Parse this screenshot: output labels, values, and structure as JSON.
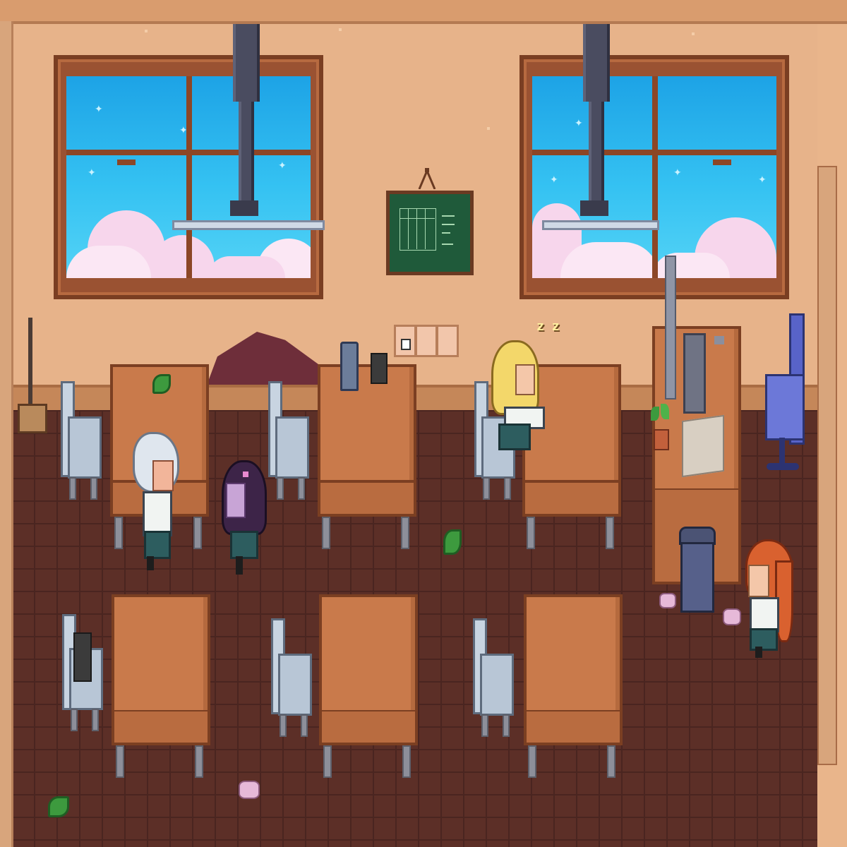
{
  "scene": {
    "location": "classroom",
    "sleep_indicator": "z z"
  },
  "colors": {
    "wall": "#e7b38a",
    "floor": "#5c2f27",
    "desk": "#c97a4b",
    "sky": "#35c2f2",
    "chalkboard": "#1f5a3a",
    "office_chair": "#5863c8"
  },
  "icons": [
    "broom",
    "water-bottle",
    "plug-adapter",
    "power-outlet",
    "potted-plant",
    "trash-can",
    "office-chair",
    "class-schedule-board",
    "leaf",
    "crumpled-paper"
  ],
  "characters": [
    {
      "id": "white-haired-student",
      "hair": "#dfe6ee"
    },
    {
      "id": "purple-haired-student",
      "hair": "#3d2448"
    },
    {
      "id": "blonde-student-sleeping",
      "hair": "#f3d76a"
    },
    {
      "id": "orange-haired-student",
      "hair": "#d9612f"
    }
  ]
}
